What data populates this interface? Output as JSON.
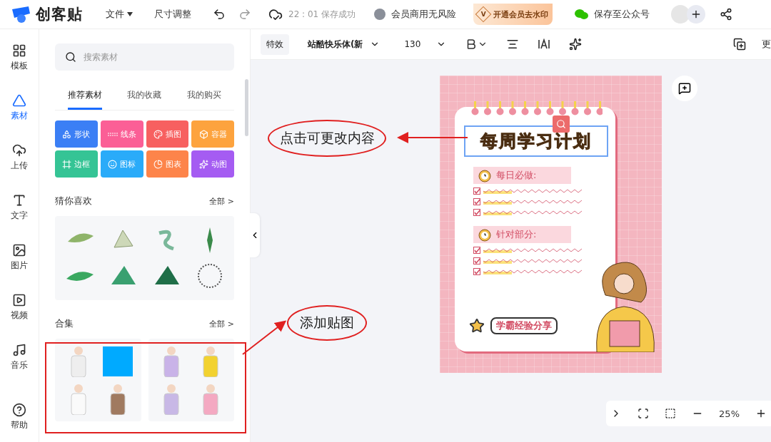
{
  "topbar": {
    "logo": "创客贴",
    "menus": [
      {
        "label": "文件",
        "kind": "dropdown"
      },
      {
        "label": "尺寸调整",
        "kind": "plain"
      }
    ],
    "save_status": "22 : 01 保存成功",
    "member_note": "会员商用无风险",
    "vip_button": "开通会员去水印",
    "vip_mark": "V",
    "wechat_save": "保存至公众号"
  },
  "rail": [
    {
      "label": "模板",
      "selected": false
    },
    {
      "label": "素材",
      "selected": true
    },
    {
      "label": "上传",
      "selected": false
    },
    {
      "label": "文字",
      "selected": false
    },
    {
      "label": "图片",
      "selected": false
    },
    {
      "label": "视频",
      "selected": false
    },
    {
      "label": "音乐",
      "selected": false
    },
    {
      "label": "帮助",
      "selected": false
    }
  ],
  "panel": {
    "search": {
      "placeholder": "搜索素材"
    },
    "tabs": [
      {
        "label": "推荐素材",
        "selected": true
      },
      {
        "label": "我的收藏",
        "selected": false
      },
      {
        "label": "我的购买",
        "selected": false
      }
    ],
    "categories": [
      {
        "label": "形状",
        "color": "#3b7ff5"
      },
      {
        "label": "线条",
        "color": "#fb5f96"
      },
      {
        "label": "插图",
        "color": "#f76060"
      },
      {
        "label": "容器",
        "color": "#fda33e"
      },
      {
        "label": "边框",
        "color": "#35c495"
      },
      {
        "label": "图标",
        "color": "#2aabf9"
      },
      {
        "label": "图表",
        "color": "#fd844a"
      },
      {
        "label": "动图",
        "color": "#a55cf2"
      }
    ],
    "sections": [
      {
        "title": "猜你喜欢",
        "more": "全部 >",
        "kind": "stickers"
      },
      {
        "title": "合集",
        "more": "全部 >",
        "kind": "collections"
      }
    ]
  },
  "toolbar": {
    "effect": "特效",
    "font": "站酷快乐体(新",
    "size": "130",
    "more": "更"
  },
  "poster": {
    "title": "每周学习计划",
    "sections": [
      {
        "heading": "每日必做:",
        "items": [
          {
            "checked": true
          },
          {
            "checked": true
          },
          {
            "checked": true
          }
        ]
      },
      {
        "heading": "针对部分:",
        "items": [
          {
            "checked": true
          },
          {
            "checked": true
          },
          {
            "checked": true
          }
        ]
      }
    ],
    "badge": "学霸经验分享"
  },
  "zoom": {
    "value": "25%"
  },
  "annotations": [
    {
      "text": "点击可更改内容",
      "kind": "callout"
    },
    {
      "text": "添加贴图",
      "kind": "callout"
    }
  ]
}
